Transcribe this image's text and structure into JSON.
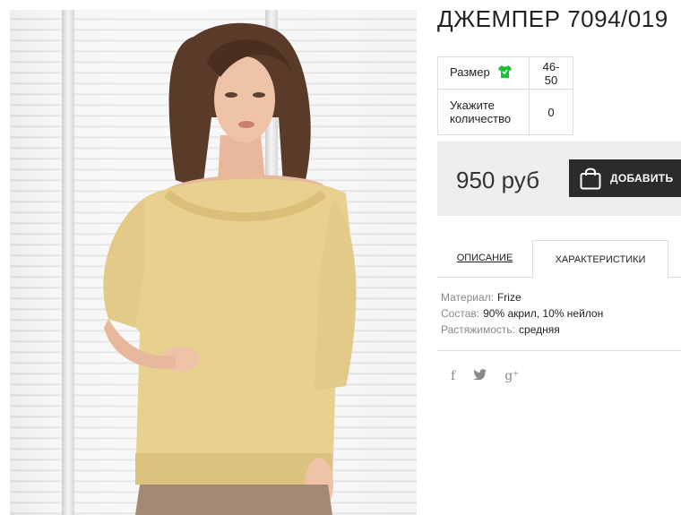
{
  "product": {
    "title": "ДЖЕМПЕР 7094/019",
    "image_alt": "Женщина в бежевом вязаном джемпере"
  },
  "params": {
    "size_label": "Размер",
    "size_value": "46-50",
    "qty_label": "Укажите количество",
    "qty_value": "0"
  },
  "purchase": {
    "price": "950 руб",
    "add_button_label": "ДОБАВИТЬ",
    "accent": "#1ec03a"
  },
  "tabs": {
    "description": "ОПИСАНИЕ",
    "characteristics": "ХАРАКТЕРИСТИКИ",
    "active": "characteristics"
  },
  "specs": [
    {
      "key": "Материал:",
      "value": "Frize"
    },
    {
      "key": "Состав:",
      "value": "90% акрил, 10% нейлон"
    },
    {
      "key": "Растяжимость:",
      "value": "средняя"
    }
  ],
  "social": {
    "facebook": "f",
    "twitter": "🐦",
    "googleplus": "g⁺"
  }
}
